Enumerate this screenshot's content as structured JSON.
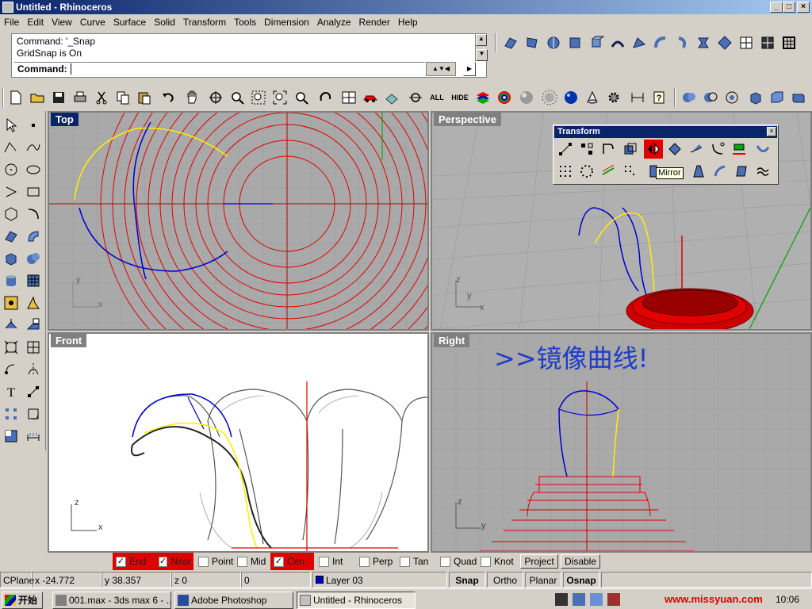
{
  "window": {
    "title": "Untitled - Rhinoceros"
  },
  "menu": [
    "File",
    "Edit",
    "View",
    "Curve",
    "Surface",
    "Solid",
    "Transform",
    "Tools",
    "Dimension",
    "Analyze",
    "Render",
    "Help"
  ],
  "command": {
    "history": [
      "Command: '_Snap",
      "GridSnap is On"
    ],
    "prompt": "Command:"
  },
  "toolbar": {
    "all_label": "ALL",
    "hide_label": "HIDE"
  },
  "viewports": {
    "top": {
      "label": "Top"
    },
    "perspective": {
      "label": "Perspective"
    },
    "front": {
      "label": "Front"
    },
    "right": {
      "label": "Right",
      "annotation": ">>镜像曲线!"
    }
  },
  "axes": {
    "x": "x",
    "y": "y",
    "z": "z"
  },
  "transform_panel": {
    "title": "Transform",
    "tooltip": "Mirror"
  },
  "osnap": {
    "items": [
      {
        "label": "End",
        "checked": true
      },
      {
        "label": "Near",
        "checked": true
      },
      {
        "label": "Point",
        "checked": false
      },
      {
        "label": "Mid",
        "checked": false
      },
      {
        "label": "Cen",
        "checked": true
      },
      {
        "label": "Int",
        "checked": false
      },
      {
        "label": "Perp",
        "checked": false
      },
      {
        "label": "Tan",
        "checked": false
      },
      {
        "label": "Quad",
        "checked": false
      },
      {
        "label": "Knot",
        "checked": false
      }
    ],
    "project": "Project",
    "disable": "Disable"
  },
  "status": {
    "cplane": "CPlane",
    "x": "x -24.772",
    "y": "y 38.357",
    "z": "z 0",
    "extra": "0",
    "layer": "Layer 03",
    "layer_color": "#0000c8",
    "snap": "Snap",
    "ortho": "Ortho",
    "planar": "Planar",
    "osnap": "Osnap"
  },
  "taskbar": {
    "start": "开始",
    "tasks": [
      "001.max - 3ds max 6 - ...",
      "Adobe Photoshop",
      "Untitled - Rhinoceros"
    ],
    "clock": "10:06",
    "watermark": "www.missyuan.com"
  },
  "colors": {
    "curve_red": "#e00000",
    "curve_blue": "#0000cc",
    "curve_yellow": "#ffee00",
    "title_blue": "#0a246a"
  }
}
